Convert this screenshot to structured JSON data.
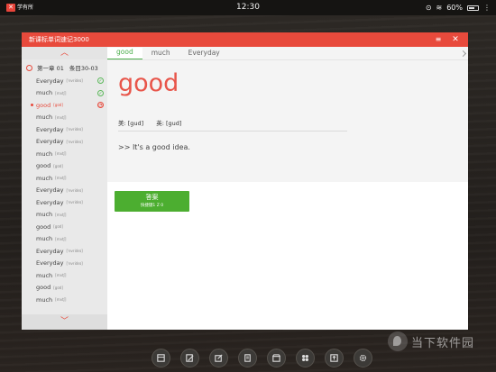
{
  "statusbar": {
    "brand_text": "学有所",
    "time": "12:30",
    "battery_percent": "60%"
  },
  "app": {
    "title": "新课标单词速记3000",
    "minimize_label": "≡",
    "close_label": "✕"
  },
  "sidebar": {
    "up_arrow": "︿",
    "down_arrow": "﹀",
    "chapter_label": "第一章 01",
    "chapter_range": "条目30-03",
    "items": [
      {
        "word": "Everyday",
        "phonetic": "[ˈevrideɪ]",
        "mark": "ok"
      },
      {
        "word": "much",
        "phonetic": "[mʌtʃ]",
        "mark": "ok"
      },
      {
        "word": "good",
        "phonetic": "[gʊd]",
        "mark": "pending",
        "active": true
      },
      {
        "word": "much",
        "phonetic": "[mʌtʃ]"
      },
      {
        "word": "Everyday",
        "phonetic": "[ˈevrideɪ]"
      },
      {
        "word": "Everyday",
        "phonetic": "[ˈevrideɪ]"
      },
      {
        "word": "much",
        "phonetic": "[mʌtʃ]"
      },
      {
        "word": "good",
        "phonetic": "[gʊd]"
      },
      {
        "word": "much",
        "phonetic": "[mʌtʃ]"
      },
      {
        "word": "Everyday",
        "phonetic": "[ˈevrideɪ]"
      },
      {
        "word": "Everyday",
        "phonetic": "[ˈevrideɪ]"
      },
      {
        "word": "much",
        "phonetic": "[mʌtʃ]"
      },
      {
        "word": "good",
        "phonetic": "[gʊd]"
      },
      {
        "word": "much",
        "phonetic": "[mʌtʃ]"
      },
      {
        "word": "Everyday",
        "phonetic": "[ˈevrideɪ]"
      },
      {
        "word": "Everyday",
        "phonetic": "[ˈevrideɪ]"
      },
      {
        "word": "much",
        "phonetic": "[mʌtʃ]"
      },
      {
        "word": "good",
        "phonetic": "[gʊd]"
      },
      {
        "word": "much",
        "phonetic": "[mʌtʃ]"
      }
    ]
  },
  "main": {
    "tabs": [
      "good",
      "much",
      "Everyday"
    ],
    "headword": "good",
    "phonetic_us": "美: [gud]",
    "phonetic_uk": "英: [gud]",
    "example": ">> It's a good idea.",
    "answer_label": "答案",
    "answer_hint": "快捷键1 Z 0"
  },
  "dock": {
    "icons": [
      "book-icon",
      "edit-note-icon",
      "compose-icon",
      "notebook-icon",
      "store-icon",
      "apps-grid-icon",
      "upload-icon",
      "settings-gear-icon"
    ]
  },
  "watermark": {
    "text": "当下软件园"
  },
  "colors": {
    "accent_red": "#e84a3c",
    "accent_green": "#4cae30"
  }
}
